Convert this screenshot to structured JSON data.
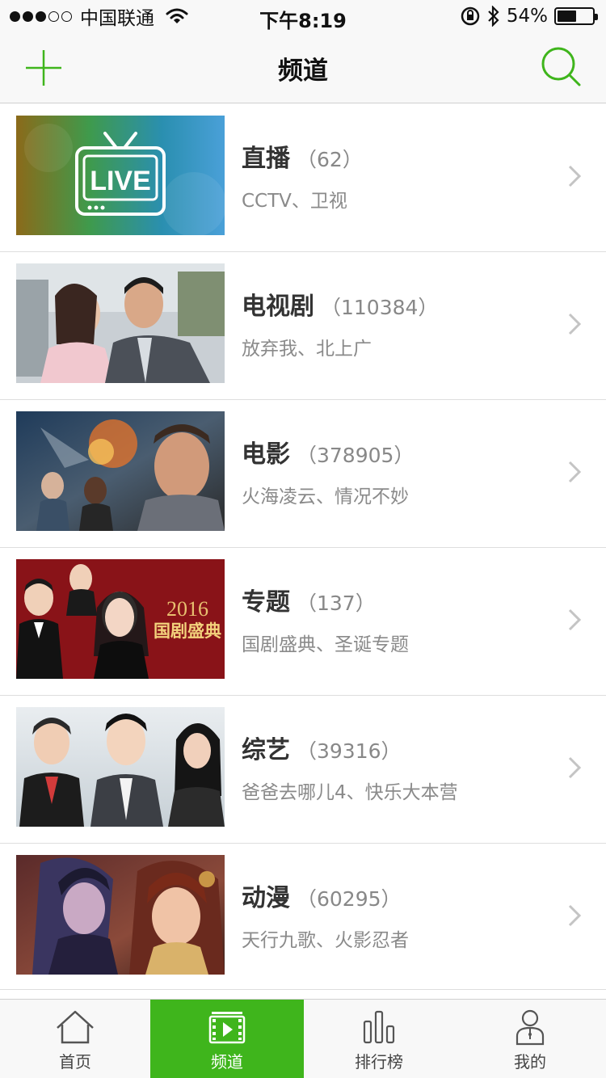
{
  "status_bar": {
    "carrier": "中国联通",
    "time": "下午8:19",
    "battery_percent": "54%",
    "battery_level": 0.54
  },
  "nav": {
    "title": "频道",
    "accent_color": "#3fb51c"
  },
  "channels": [
    {
      "title": "直播",
      "count": "（62）",
      "subtitle": "CCTV、卫视",
      "thumb_text": "LIVE"
    },
    {
      "title": "电视剧",
      "count": "（110384）",
      "subtitle": "放弃我、北上广"
    },
    {
      "title": "电影",
      "count": "（378905）",
      "subtitle": "火海凌云、情况不妙"
    },
    {
      "title": "专题",
      "count": "（137）",
      "subtitle": "国剧盛典、圣诞专题",
      "thumb_text": "2016",
      "thumb_text_2": "国剧盛典"
    },
    {
      "title": "综艺",
      "count": "（39316）",
      "subtitle": "爸爸去哪儿4、快乐大本营"
    },
    {
      "title": "动漫",
      "count": "（60295）",
      "subtitle": "天行九歌、火影忍者"
    }
  ],
  "tabs": [
    {
      "label": "首页",
      "icon": "home-icon",
      "active": false
    },
    {
      "label": "频道",
      "icon": "film-play-icon",
      "active": true
    },
    {
      "label": "排行榜",
      "icon": "bar-chart-icon",
      "active": false
    },
    {
      "label": "我的",
      "icon": "person-icon",
      "active": false
    }
  ]
}
